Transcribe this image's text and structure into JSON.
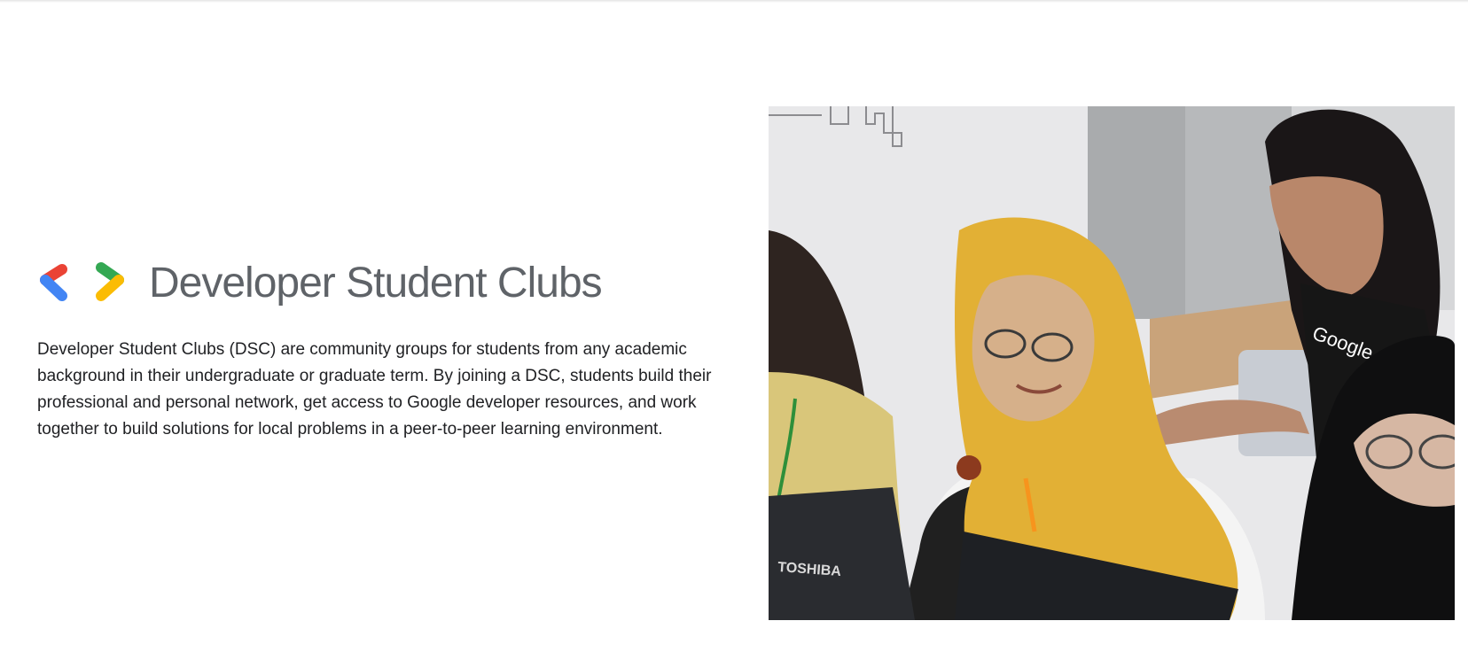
{
  "brand": {
    "name": "Developer Student Clubs",
    "logo_colors": {
      "red": "#ea4335",
      "blue": "#4285f4",
      "green": "#34a853",
      "yellow": "#fbbc04"
    }
  },
  "description": "Developer Student Clubs (DSC) are community groups for students from any academic background in their undergraduate or graduate term. By joining a DSC, students build their professional and personal network, get access to Google developer resources, and work together to build solutions for local problems in a peer-to-peer learning environment.",
  "photo": {
    "laptop_brand": "TOSHIBA",
    "shirt_text": "Google"
  }
}
